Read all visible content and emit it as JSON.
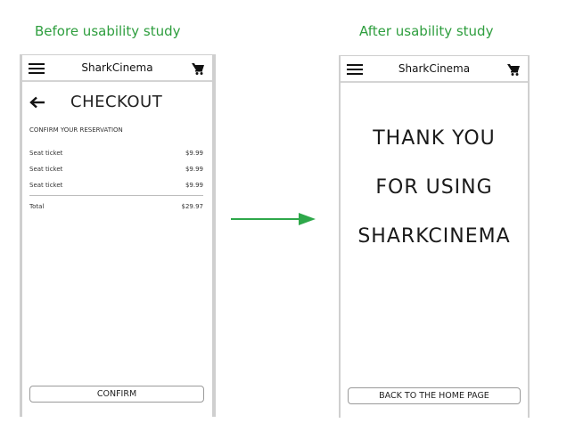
{
  "captions": {
    "before": "Before usability study",
    "after": "After usability study"
  },
  "colors": {
    "caption_green": "#2e9e3e",
    "arrow_green": "#2ea84a"
  },
  "before_screen": {
    "brand": "SharkCinema",
    "icons": [
      "menu-icon",
      "cart-icon",
      "back-arrow-icon"
    ],
    "heading": "CHECKOUT",
    "subheading": "CONFIRM YOUR RESERVATION",
    "items": [
      {
        "label": "Seat ticket",
        "price": "$9.99"
      },
      {
        "label": "Seat ticket",
        "price": "$9.99"
      },
      {
        "label": "Seat ticket",
        "price": "$9.99"
      }
    ],
    "total": {
      "label": "Total",
      "price": "$29.97"
    },
    "button": "CONFIRM"
  },
  "after_screen": {
    "brand": "SharkCinema",
    "icons": [
      "menu-icon",
      "cart-icon"
    ],
    "lines": [
      "THANK YOU",
      "FOR USING",
      "SHARKCINEMA"
    ],
    "button": "BACK TO THE HOME PAGE"
  }
}
